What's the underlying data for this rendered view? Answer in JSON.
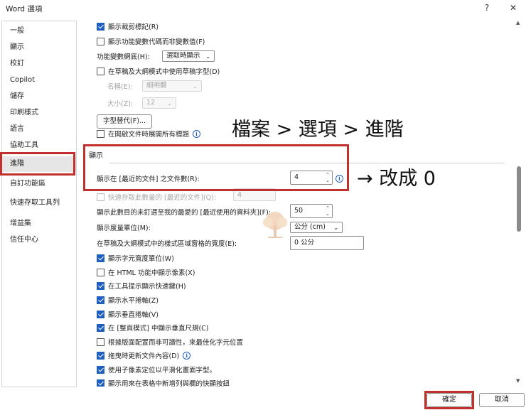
{
  "window": {
    "title": "Word 選項",
    "help": "?",
    "close": "✕"
  },
  "sidebar": {
    "items": [
      {
        "label": "一般"
      },
      {
        "label": "顯示"
      },
      {
        "label": "校訂"
      },
      {
        "label": "Copilot"
      },
      {
        "label": "儲存"
      },
      {
        "label": "印刷樣式"
      },
      {
        "label": "語言"
      },
      {
        "label": "協助工具"
      },
      {
        "label": "進階",
        "selected": true
      },
      {
        "label": "自訂功能區"
      },
      {
        "label": "快速存取工具列"
      },
      {
        "label": "增益集"
      },
      {
        "label": "信任中心"
      }
    ]
  },
  "content": {
    "show_crop_marks": {
      "label": "顯示裁剪標記(R)",
      "checked": true
    },
    "show_field_codes": {
      "label": "顯示功能變數代碼而非變數值(F)",
      "checked": false
    },
    "field_shading": {
      "label": "功能變數網底(H):",
      "value": "選取時顯示"
    },
    "draft_font": {
      "label": "在草稿及大綱模式中使用草稿字型(D)",
      "checked": false
    },
    "font_name": {
      "label": "名稱(E):",
      "value": "細明體"
    },
    "font_size": {
      "label": "大小(Z):",
      "value": "12"
    },
    "font_sub_button": "字型替代(F)...",
    "expand_headings": {
      "label": "在開啟文件時展開所有標題",
      "checked": false
    },
    "display_section": {
      "title": "顯示",
      "recent_docs": {
        "label": "顯示在 [最近的文件] 之文件數(R):",
        "value": "4"
      },
      "quick_access": {
        "label": "快速存取此數量的 [最近的文件](Q):",
        "value": "4",
        "checked": false
      },
      "recent_folders": {
        "label": "顯示此數目的未釘選至我的最愛的 [最近使用的資料夾](F):",
        "value": "50"
      },
      "units": {
        "label": "顯示度量單位(M):",
        "value": "公分 (cm)"
      },
      "style_pane": {
        "label": "在草稿及大綱模式中的樣式區域窗格的寬度(E):",
        "value": "0 公分"
      },
      "checks": [
        {
          "label": "顯示字元寬度單位(W)",
          "checked": true
        },
        {
          "label": "在 HTML 功能中顯示像素(X)",
          "checked": false
        },
        {
          "label": "在工具提示顯示快速鍵(H)",
          "checked": true
        },
        {
          "label": "顯示水平捲軸(Z)",
          "checked": true
        },
        {
          "label": "顯示垂直捲軸(V)",
          "checked": true
        },
        {
          "label": "在 [整頁模式] 中顯示垂直尺規(C)",
          "checked": true
        },
        {
          "label": "根據版面配置而非可讀性，來最佳化字元位置",
          "checked": false
        },
        {
          "label": "拖曳時更新文件內容(D)",
          "checked": true,
          "info": true
        },
        {
          "label": "使用子像素定位以平滑化畫面字型。",
          "checked": true
        },
        {
          "label": "顯示用來在表格中新增列與欄的快顯按鈕",
          "checked": true
        }
      ]
    }
  },
  "annotations": {
    "path": "檔案  > 選項 > 進階",
    "change": "→ 改成 0"
  },
  "footer": {
    "ok": "確定",
    "cancel": "取消"
  },
  "colors": {
    "accent": "#1f5fbf",
    "highlight": "#c0312e"
  }
}
